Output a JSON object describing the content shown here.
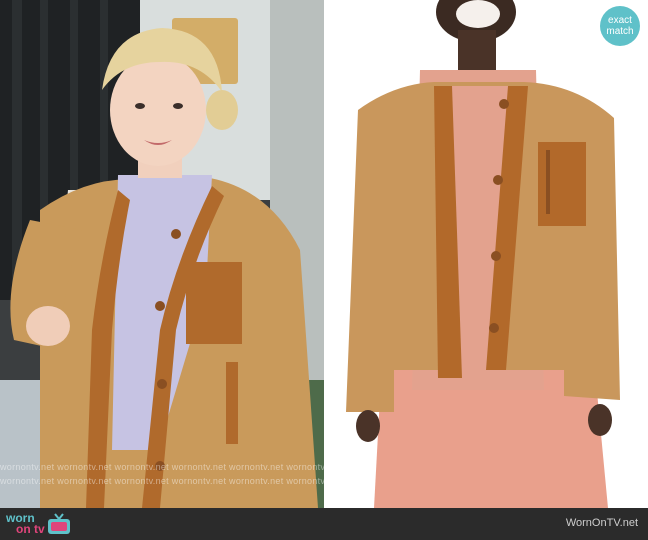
{
  "badge": {
    "line1": "exact",
    "line2": "match"
  },
  "watermark": "wornontv.net",
  "footer": {
    "brand_line1": "worn",
    "brand_line2": "on tv",
    "site": "WornOnTV.net"
  },
  "colors": {
    "jacket_sherpa": "#c99a5b",
    "jacket_trim": "#b06a2c",
    "badge": "#5fc1c9",
    "footer_bg": "#2b2b2b",
    "brand_accent": "#e0457b"
  }
}
